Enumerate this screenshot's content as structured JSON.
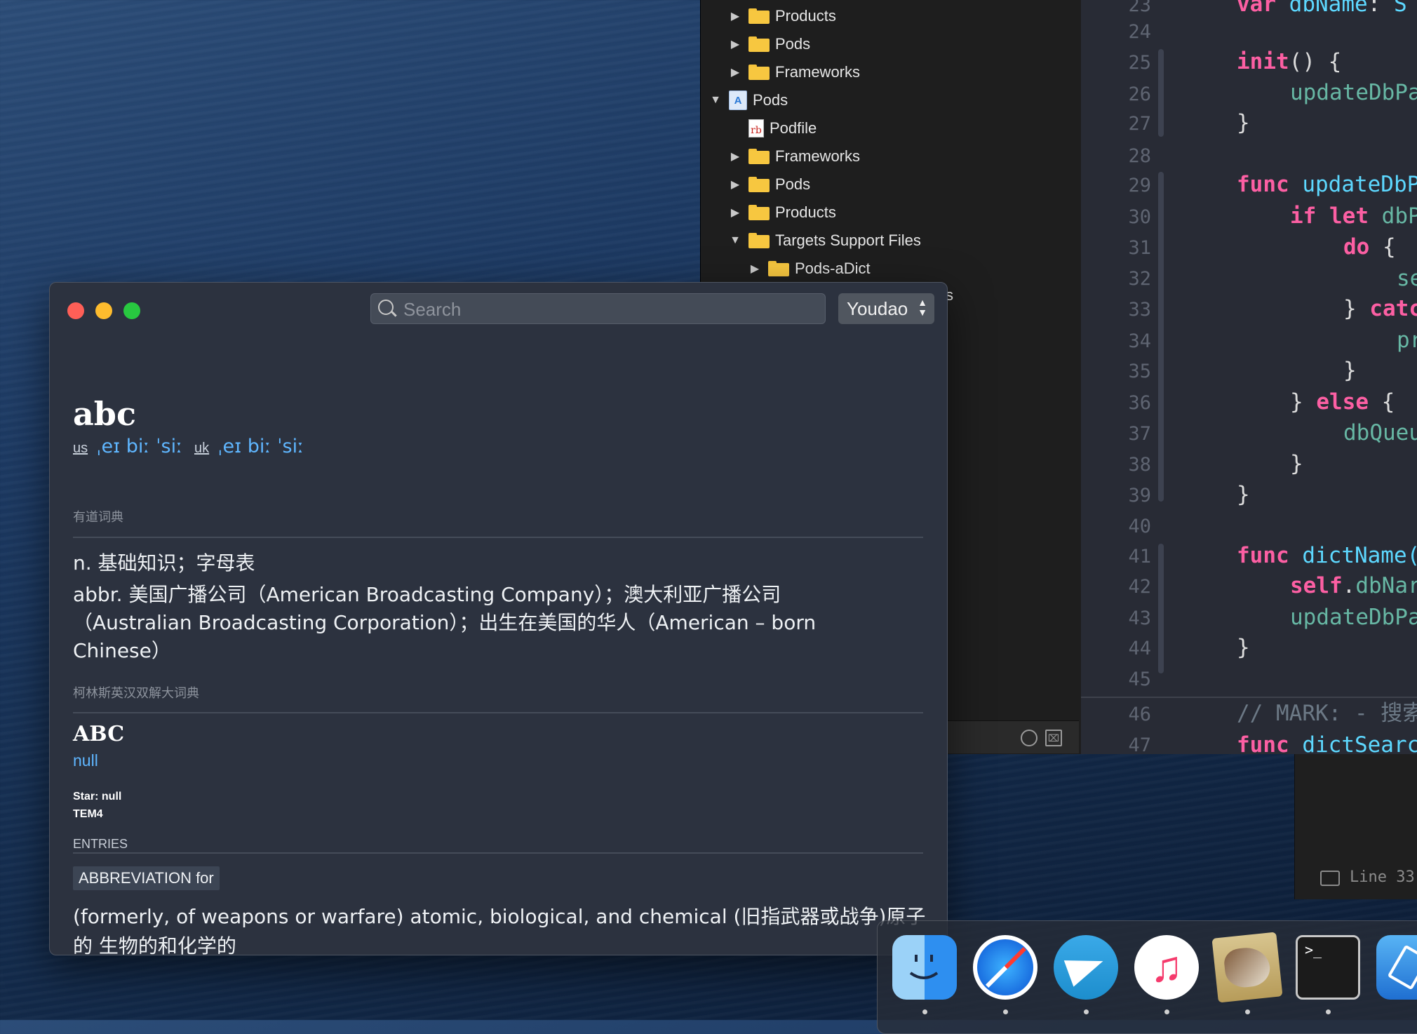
{
  "xcode_navigator": {
    "items": [
      {
        "label": "Products",
        "expanded": false,
        "icon": "folder-icon"
      },
      {
        "label": "Pods",
        "expanded": false,
        "icon": "folder-icon"
      },
      {
        "label": "Frameworks",
        "expanded": false,
        "icon": "folder-icon"
      },
      {
        "label": "Pods",
        "expanded": true,
        "icon": "xcodeproj-icon"
      },
      {
        "label": "Podfile",
        "expanded": null,
        "icon": "ruby-file-icon"
      },
      {
        "label": "Frameworks",
        "expanded": false,
        "icon": "folder-icon"
      },
      {
        "label": "Pods",
        "expanded": false,
        "icon": "folder-icon"
      },
      {
        "label": "Products",
        "expanded": false,
        "icon": "folder-icon"
      },
      {
        "label": "Targets Support Files",
        "expanded": true,
        "icon": "folder-icon"
      },
      {
        "label": "Pods-aDict",
        "expanded": false,
        "icon": "folder-icon"
      }
    ],
    "partial_text": "s"
  },
  "editor": {
    "line_numbers": [
      "23",
      "24",
      "25",
      "26",
      "27",
      "28",
      "29",
      "30",
      "31",
      "32",
      "33",
      "34",
      "35",
      "36",
      "37",
      "38",
      "39",
      "40",
      "41",
      "42",
      "43",
      "44",
      "45",
      "46",
      "47"
    ],
    "status_label": "Line 33"
  },
  "dictionary": {
    "search": {
      "placeholder": "Search",
      "value": ""
    },
    "engine": "Youdao",
    "headword": "abc",
    "phonetics": {
      "us_label": "us",
      "us_ipa": "ˌeɪ biː ˈsiː",
      "uk_label": "uk",
      "uk_ipa": "ˌeɪ biː ˈsiː"
    },
    "youdao": {
      "section_title": "有道词典",
      "definitions": [
        "n. 基础知识；字母表",
        "abbr. 美国广播公司（American Broadcasting Company）；澳大利亚广播公司（Australian Broadcasting Corporation）；出生在美国的华人（American – born Chinese）"
      ]
    },
    "collins": {
      "section_title": "柯林斯英汉双解大词典",
      "word": "ABC",
      "phonetic": "null",
      "star": "Star: null",
      "exam": "TEM4",
      "entries_title": "ENTRIES",
      "entry_tag": "ABBREVIATION for",
      "entry_text": "(formerly, of weapons or warfare) atomic, biological, and chemical (旧指武器或战争)原子的 生物的和化学的"
    }
  },
  "dock": {
    "apps": [
      "Finder",
      "Safari",
      "Telegram",
      "Music",
      "Mail",
      "Terminal",
      "Xcode"
    ],
    "terminal_prompt": ">_"
  }
}
